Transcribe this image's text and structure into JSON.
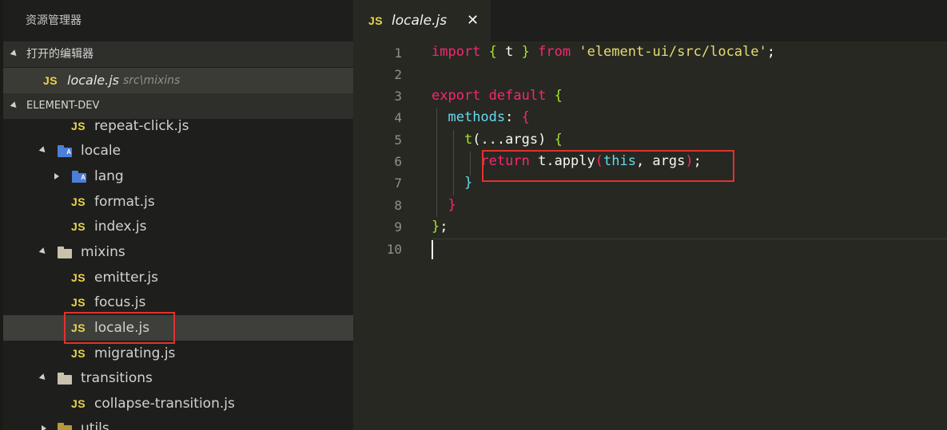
{
  "sidebar": {
    "title": "资源管理器",
    "open_editors_label": "打开的编辑器",
    "open_editor": {
      "badge": "JS",
      "name": "locale.js",
      "path": "src\\mixins"
    },
    "project_label": "ELEMENT-DEV",
    "tree": [
      {
        "type": "file",
        "badge": "JS",
        "name": "repeat-click.js"
      },
      {
        "type": "folder",
        "name": "locale",
        "expanded": true,
        "icon": "locale-folder-icon"
      },
      {
        "type": "folder",
        "name": "lang",
        "expanded": false,
        "icon": "lang-folder-icon"
      },
      {
        "type": "file",
        "badge": "JS",
        "name": "format.js"
      },
      {
        "type": "file",
        "badge": "JS",
        "name": "index.js"
      },
      {
        "type": "folder",
        "name": "mixins",
        "expanded": true,
        "icon": "folder-icon"
      },
      {
        "type": "file",
        "badge": "JS",
        "name": "emitter.js"
      },
      {
        "type": "file",
        "badge": "JS",
        "name": "focus.js"
      },
      {
        "type": "file",
        "badge": "JS",
        "name": "locale.js",
        "selected": true
      },
      {
        "type": "file",
        "badge": "JS",
        "name": "migrating.js"
      },
      {
        "type": "folder",
        "name": "transitions",
        "expanded": true,
        "icon": "folder-icon"
      },
      {
        "type": "file",
        "badge": "JS",
        "name": "collapse-transition.js"
      },
      {
        "type": "folder",
        "name": "utils",
        "expanded": false,
        "icon": "utils-folder-icon"
      }
    ]
  },
  "editor": {
    "tab": {
      "badge": "JS",
      "name": "locale.js",
      "close_glyph": "✕"
    },
    "line_numbers": [
      "1",
      "2",
      "3",
      "4",
      "5",
      "6",
      "7",
      "8",
      "9",
      "10"
    ],
    "code": {
      "l1": {
        "import": "import",
        "lb": "{",
        "t": " t ",
        "rb": "}",
        "from": "from",
        "str": "'element-ui/src/locale'",
        "semi": ";"
      },
      "l3": {
        "export": "export",
        "default": "default",
        "brace": "{"
      },
      "l4": {
        "methods": "methods",
        "colon": ": ",
        "brace": "{"
      },
      "l5": {
        "fn": "t",
        "params": "(...args)",
        "brace": " {"
      },
      "l6": {
        "return": "return",
        "t": " t.",
        "apply": "apply",
        "lp": "(",
        "this": "this",
        "args": ", args",
        "rp": ")",
        "semi": ";"
      },
      "l7": {
        "brace": "}"
      },
      "l8": {
        "brace": "}"
      },
      "l9": {
        "brace": "}",
        "semi": ";"
      }
    }
  },
  "colors": {
    "background": "#272822",
    "sidebar": "#1e1f1c",
    "highlight_box": "#e0322f",
    "js_badge": "#e9d44d"
  }
}
